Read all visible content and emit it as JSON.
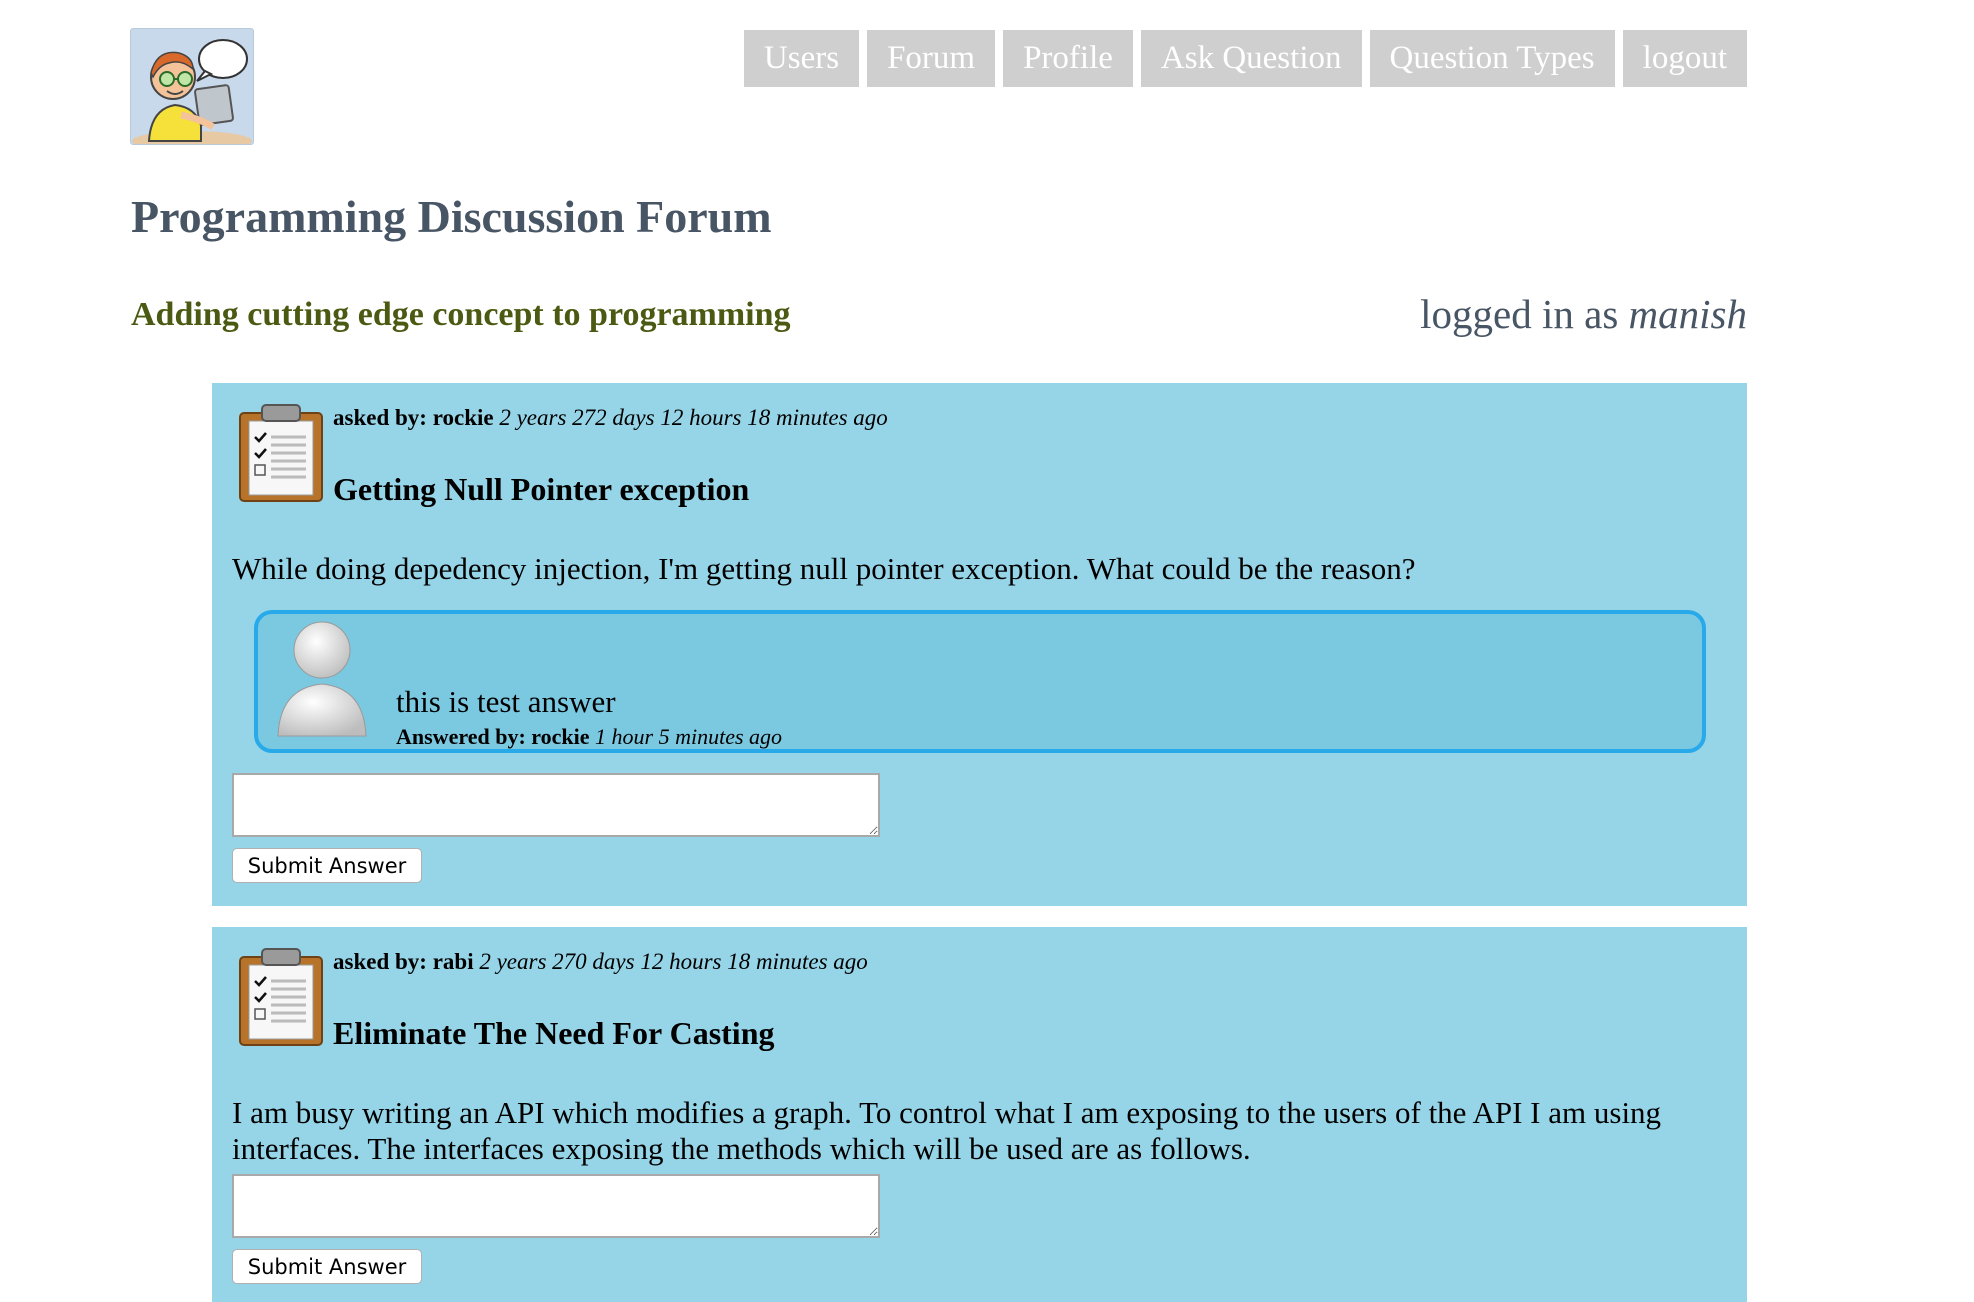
{
  "header": {
    "logo_icon": "programmer-cartoon-logo",
    "nav": [
      "Users",
      "Forum",
      "Profile",
      "Ask Question",
      "Question Types",
      "logout"
    ]
  },
  "site": {
    "title": "Programming Discussion Forum",
    "tagline": "Adding cutting edge concept to programming",
    "logged_in_prefix": "logged in as",
    "logged_in_user": "manish"
  },
  "questions": [
    {
      "asked_by_label": "asked by: rockie",
      "asked_time": "2 years 272 days 12 hours 18 minutes ago",
      "title": "Getting Null Pointer exception",
      "body": "While doing depedency injection, I'm getting null pointer exception. What could be the reason?",
      "answers": [
        {
          "text": "this is test answer",
          "answered_by_label": "Answered by: rockie",
          "time": "1 hour 5 minutes ago"
        }
      ],
      "input_value": "",
      "submit_label": "Submit Answer"
    },
    {
      "asked_by_label": "asked by: rabi",
      "asked_time": "2 years 270 days 12 hours 18 minutes ago",
      "title": "Eliminate The Need For Casting",
      "body": "I am busy writing an API which modifies a graph. To control what I am exposing to the users of the API I am using interfaces. The interfaces exposing the methods which will be used are as follows.",
      "answers": [],
      "input_value": "",
      "submit_label": "Submit Answer"
    }
  ],
  "colors": {
    "nav_bg": "#cfcfcf",
    "title": "#475564",
    "tagline": "#4b5a12",
    "card_bg": "#96d4e7",
    "answer_bg": "#7bc8e1",
    "answer_border": "#27a9ea"
  }
}
